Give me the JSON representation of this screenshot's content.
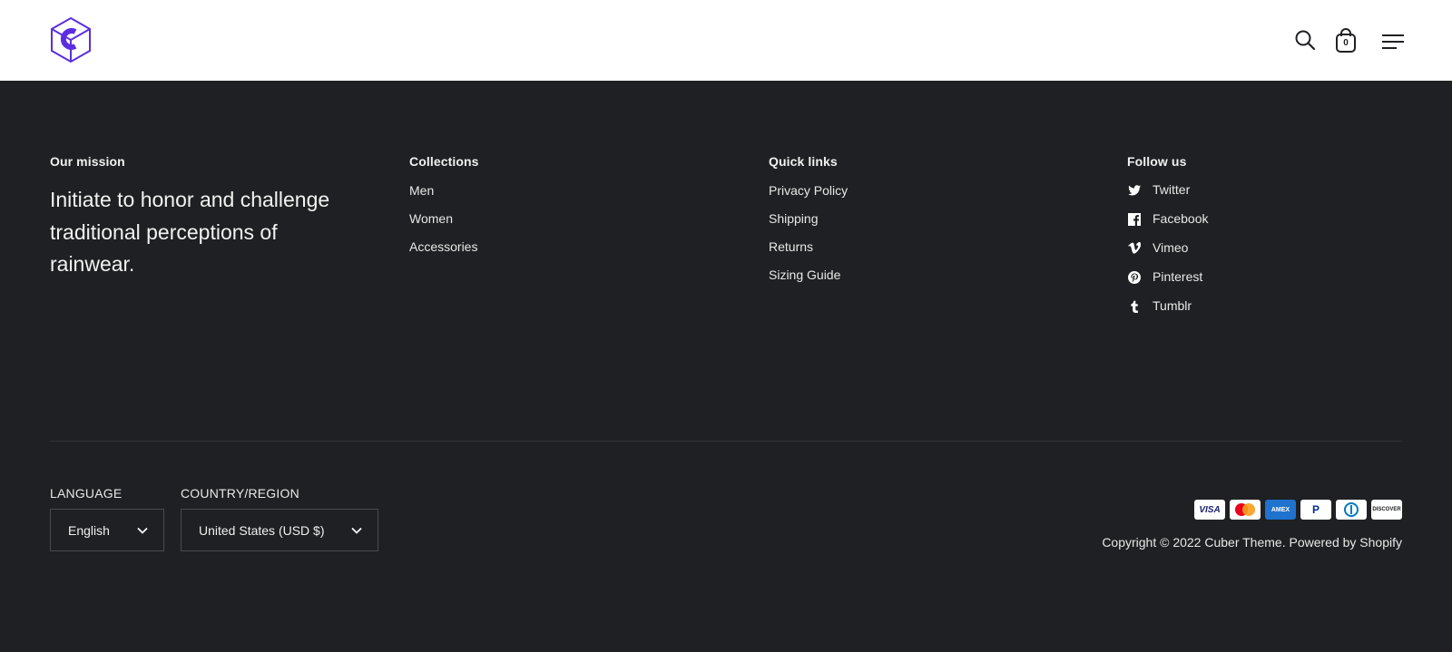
{
  "header": {
    "logo_icon": "cube-c-logo-icon",
    "brand_color": "#5b2ee0",
    "search_icon": "search-icon",
    "cart_icon": "shopping-bag-icon",
    "cart_count": "0",
    "menu_icon": "hamburger-menu-icon"
  },
  "footer": {
    "mission": {
      "title": "Our mission",
      "text": "Initiate to honor and challenge traditional perceptions of rainwear."
    },
    "collections": {
      "title": "Collections",
      "links": [
        "Men",
        "Women",
        "Accessories"
      ]
    },
    "quick_links": {
      "title": "Quick links",
      "links": [
        "Privacy Policy",
        "Shipping",
        "Returns",
        "Sizing Guide"
      ]
    },
    "follow_us": {
      "title": "Follow us",
      "links": [
        {
          "label": "Twitter",
          "icon": "twitter-icon"
        },
        {
          "label": "Facebook",
          "icon": "facebook-icon"
        },
        {
          "label": "Vimeo",
          "icon": "vimeo-icon"
        },
        {
          "label": "Pinterest",
          "icon": "pinterest-icon"
        },
        {
          "label": "Tumblr",
          "icon": "tumblr-icon"
        }
      ]
    },
    "language": {
      "label": "LANGUAGE",
      "selected": "English"
    },
    "country": {
      "label": "COUNTRY/REGION",
      "selected": "United States (USD $)"
    },
    "payments": {
      "visa": "VISA",
      "mastercard_icon": "mastercard-icon",
      "amex": "AMEX",
      "paypal": "P",
      "diners_icon": "diners-club-icon",
      "discover": "DISCOVER"
    },
    "copyright": "Copyright © 2022 Cuber Theme. Powered by Shopify"
  },
  "colors": {
    "footer_bg": "#1f2023",
    "header_bg": "#ffffff",
    "text": "#e8e8e8"
  }
}
